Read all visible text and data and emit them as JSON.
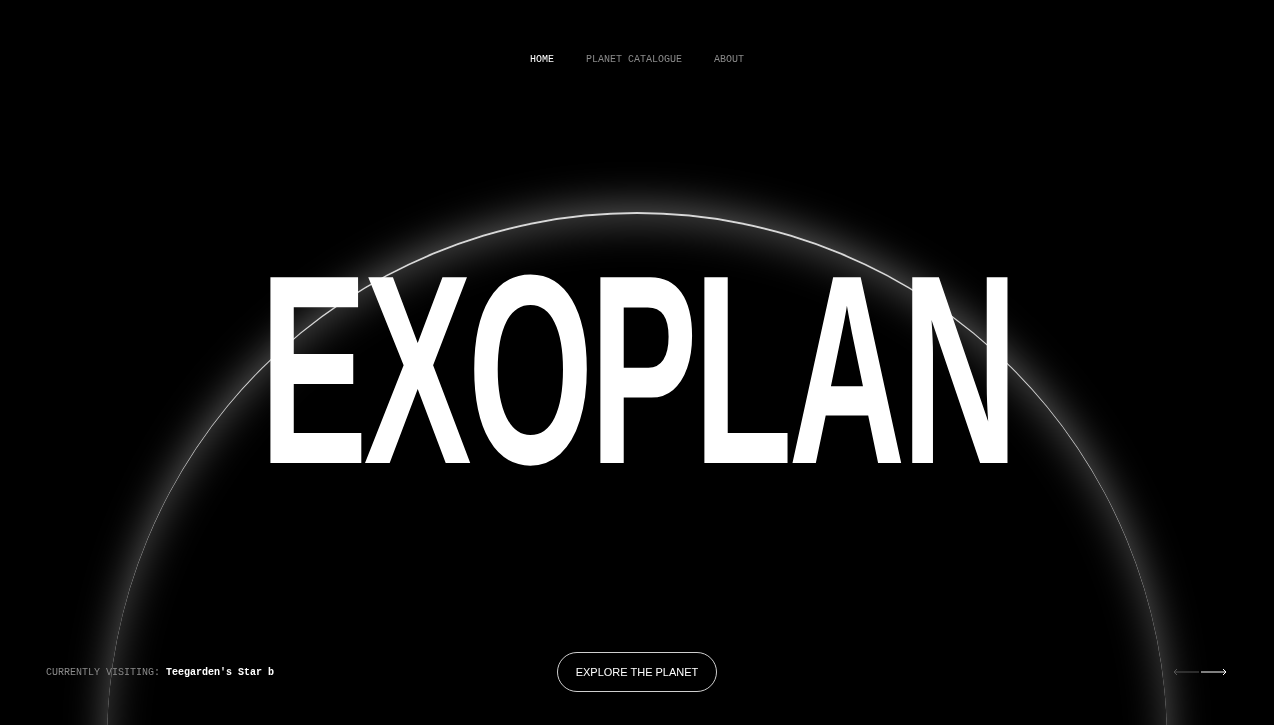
{
  "nav": [
    {
      "label": "HOME",
      "selected": true
    },
    {
      "label": "PLANET CATALOGUE",
      "selected": false
    },
    {
      "label": "ABOUT",
      "selected": false
    }
  ],
  "hero": {
    "title": "EXOPLAN"
  },
  "footer": {
    "visiting_label": "CURRENTLY VISITING:",
    "visiting_value": "Teegarden's Star b",
    "button": "EXPLORE THE PLANET"
  }
}
